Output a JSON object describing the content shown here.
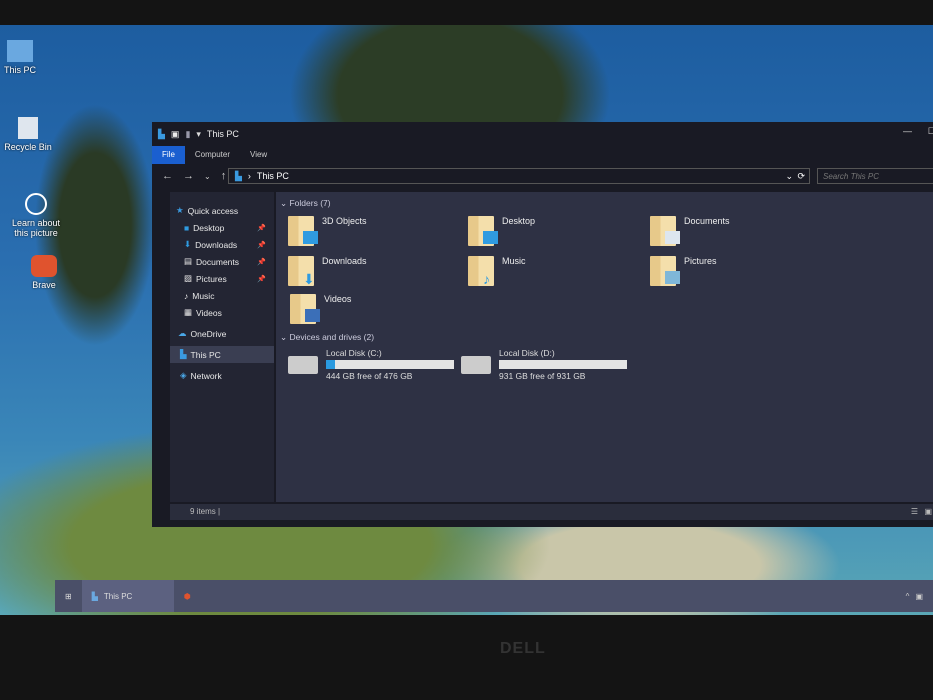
{
  "desktop": {
    "icons": [
      {
        "label": "This PC"
      },
      {
        "label": "Recycle Bin"
      },
      {
        "label": "Learn about this picture"
      },
      {
        "label": "Brave"
      }
    ]
  },
  "window": {
    "title": "This PC",
    "ribbon_tabs": [
      "File",
      "Computer",
      "View"
    ],
    "address": "This PC",
    "search_placeholder": "Search This PC",
    "sidebar": [
      {
        "label": "Quick access"
      },
      {
        "label": "Desktop",
        "pinned": true
      },
      {
        "label": "Downloads",
        "pinned": true
      },
      {
        "label": "Documents",
        "pinned": true
      },
      {
        "label": "Pictures",
        "pinned": true
      },
      {
        "label": "Music"
      },
      {
        "label": "Videos"
      },
      {
        "label": "OneDrive"
      },
      {
        "label": "This PC"
      },
      {
        "label": "Network"
      }
    ],
    "folders_header": "Folders (7)",
    "folders": [
      "3D Objects",
      "Desktop",
      "Documents",
      "Downloads",
      "Music",
      "Pictures",
      "Videos"
    ],
    "drives_header": "Devices and drives (2)",
    "drives": [
      {
        "name": "Local Disk (C:)",
        "info": "444 GB free of 476 GB",
        "used_fraction": 0.067
      },
      {
        "name": "Local Disk (D:)",
        "info": "931 GB free of 931 GB",
        "used_fraction": 0.0
      }
    ],
    "status": "9 items  |"
  },
  "taskbar": {
    "active": "This PC"
  },
  "brand": "DELL",
  "colors": {
    "accent": "#1a5fd0",
    "drive_bar": "#2a9ae0"
  }
}
